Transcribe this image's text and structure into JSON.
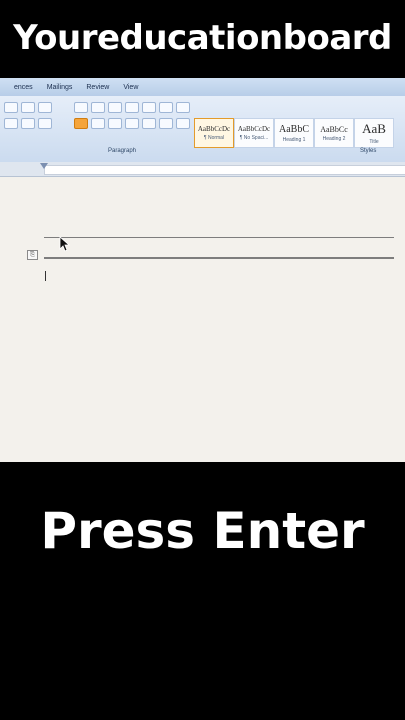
{
  "captions": {
    "top": "Youreducationboard",
    "bottom": "Press Enter"
  },
  "ribbon": {
    "tabs": [
      "ences",
      "Mailings",
      "Review",
      "View"
    ],
    "paragraph_label": "Paragraph",
    "styles_label": "Styles",
    "styles": [
      {
        "sample": "AaBbCcDc",
        "name": "¶ Normal"
      },
      {
        "sample": "AaBbCcDc",
        "name": "¶ No Spaci..."
      },
      {
        "sample": "AaBbC",
        "name": "Heading 1"
      },
      {
        "sample": "AaBbCc",
        "name": "Heading 2"
      },
      {
        "sample": "AaB",
        "name": "Title"
      }
    ]
  },
  "colors": {
    "caption_text": "#ffffff",
    "ribbon_bg": "#cbdbef",
    "selected_style": "#e39b2b"
  }
}
